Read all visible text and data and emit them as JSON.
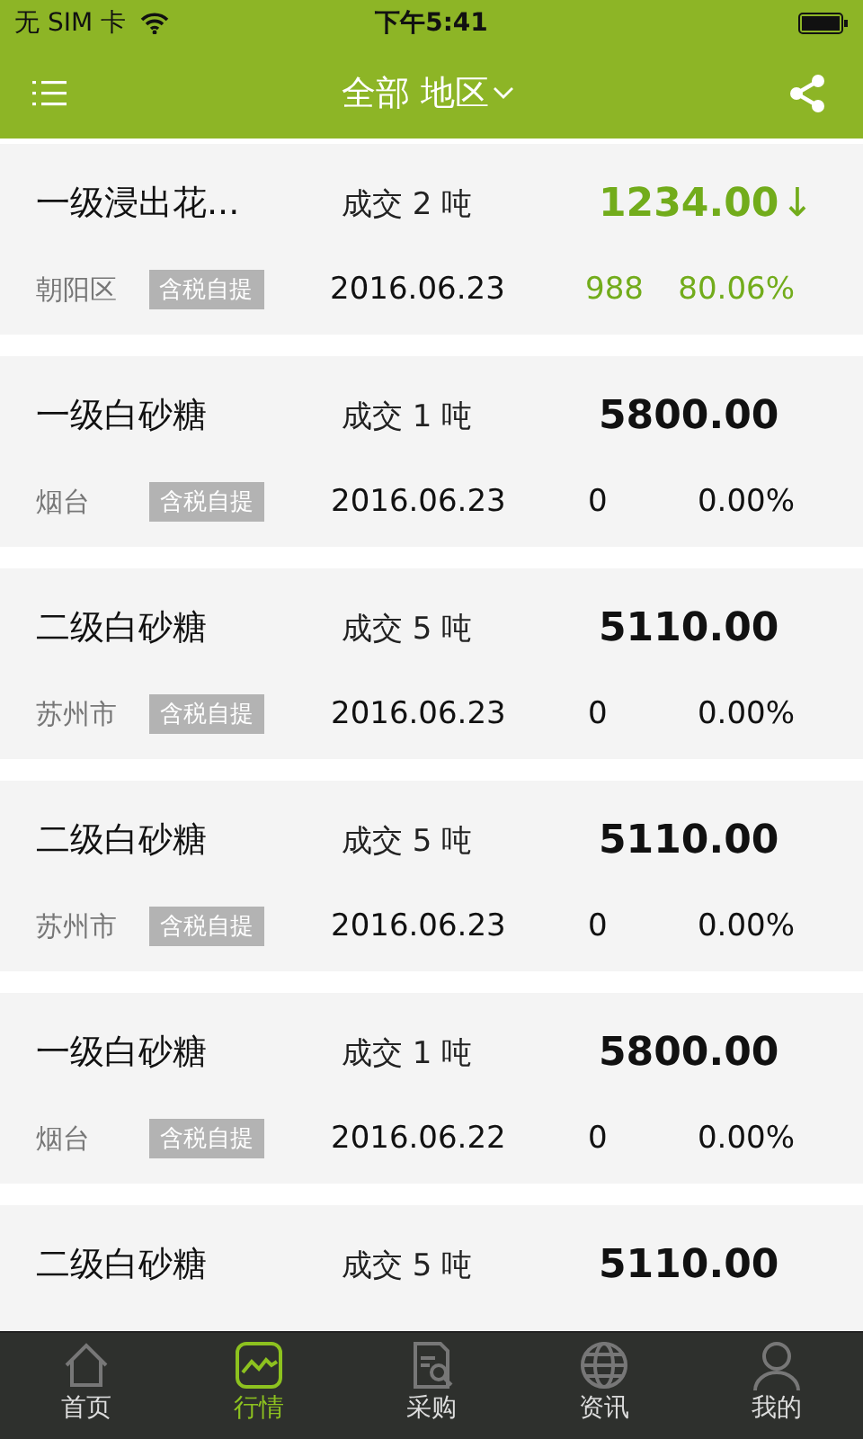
{
  "status_bar": {
    "carrier": "无 SIM 卡",
    "time": "下午5:41"
  },
  "header": {
    "title": "全部 地区"
  },
  "items": [
    {
      "name": "一级浸出花...",
      "volume": "成交 2 吨",
      "price": "1234.00",
      "arrow": "↓",
      "color": "#72ac1b",
      "region": "朝阳区",
      "tag": "含税自提",
      "date": "2016.06.23",
      "change": "988",
      "percent": "80.06%"
    },
    {
      "name": "一级白砂糖",
      "volume": "成交 1 吨",
      "price": "5800.00",
      "color": "#111111",
      "region": "烟台",
      "tag": "含税自提",
      "date": "2016.06.23",
      "change": "0",
      "percent": "0.00%"
    },
    {
      "name": "二级白砂糖",
      "volume": "成交 5 吨",
      "price": "5110.00",
      "color": "#111111",
      "region": "苏州市",
      "tag": "含税自提",
      "date": "2016.06.23",
      "change": "0",
      "percent": "0.00%"
    },
    {
      "name": "二级白砂糖",
      "volume": "成交 5 吨",
      "price": "5110.00",
      "color": "#111111",
      "region": "苏州市",
      "tag": "含税自提",
      "date": "2016.06.23",
      "change": "0",
      "percent": "0.00%"
    },
    {
      "name": "一级白砂糖",
      "volume": "成交 1 吨",
      "price": "5800.00",
      "color": "#111111",
      "region": "烟台",
      "tag": "含税自提",
      "date": "2016.06.22",
      "change": "0",
      "percent": "0.00%"
    },
    {
      "name": "二级白砂糖",
      "volume": "成交 5 吨",
      "price": "5110.00",
      "color": "#111111"
    }
  ],
  "tabs": [
    {
      "label": "首页",
      "selected": false
    },
    {
      "label": "行情",
      "selected": true
    },
    {
      "label": "采购",
      "selected": false
    },
    {
      "label": "资讯",
      "selected": false
    },
    {
      "label": "我的",
      "selected": false
    }
  ]
}
